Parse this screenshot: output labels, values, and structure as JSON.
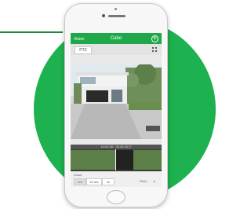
{
  "app_bar": {
    "left_label": "Vision",
    "title": "Cabo"
  },
  "toolbar": {
    "ptz_label": "PTZ"
  },
  "timeline": {
    "header": "10:02:38 · 05.06.2017"
  },
  "controls": {
    "section_label": "Zoom",
    "segments": [
      "1m",
      "10 sec",
      "1h"
    ],
    "rate_label": "Fluid",
    "arrow": "▸"
  },
  "colors": {
    "brand_green": "#1eb14f",
    "app_bar": "#1fa84a",
    "track": "#5c7f48"
  }
}
